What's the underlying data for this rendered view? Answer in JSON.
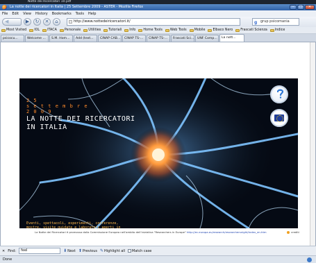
{
  "os_title": "Notte dei Ricercatori 10.pdf",
  "window": {
    "title": "La notte dei ricercatori in Italia | 25 Settembre 2009 - ASTER - Mozilla Firefox",
    "minimize": "–",
    "maximize": "□",
    "close": "✕"
  },
  "menu": [
    "File",
    "Edit",
    "View",
    "History",
    "Bookmarks",
    "Tools",
    "Help"
  ],
  "nav": {
    "back": "◀",
    "forward": "▶",
    "reload": "↻",
    "stop": "✕",
    "home": "⌂",
    "url": "http://www.nottedeiricercatori.it/",
    "search_engine": "g",
    "search_value": "grup psicomania",
    "go": "▶"
  },
  "bookmarks": [
    "Most Visited",
    "IOL",
    "ITACA",
    "Personale",
    "Utilities",
    "Tutoriali",
    "Info",
    "Home Tools",
    "Web Tools",
    "Mobile",
    "Elbaco Nero",
    "Frascati Scienza",
    "Indice"
  ],
  "tabs": [
    "psicocu...",
    "Welcome ...",
    "S.M. Hom...",
    "Add (text...",
    "CINAP CAB...",
    "CINAP TS-...",
    "CINAP TS-...",
    "Frascati Sci...",
    "UNF Comp...",
    "La nott..."
  ],
  "banner": {
    "date_line1": "2 5",
    "date_line2": "s e t t e m b r e",
    "date_line3": "2 0 0 9",
    "title_line1": "LA NOTTE DEI RICERCATORI",
    "title_line2": "IN ITALIA",
    "body": "Eventi, spettacoli, esperimenti, conferenze, mostre, visite guidate e laboratori aperti in compagnia dei ricercatori. Tutto nella stessa notte, in Italia. E in Europa.",
    "help_icon": "question-mark",
    "eu_icon": "eu-flag"
  },
  "footer": {
    "note": "La Notte dei Ricercatori è promossa dalla Commissione Europea nell'ambito dell'iniziativa \"Researchers in Europe\"",
    "link": "http://ec.europa.eu/research/researchersnight/index_en.htm",
    "credits": "crediti"
  },
  "findbar": {
    "close": "✕",
    "label": "Find:",
    "value": "feel",
    "next": "Next",
    "previous": "Previous",
    "highlight": "Highlight all",
    "match_case": "Match case"
  },
  "status": "Done",
  "colors": {
    "banner_bg": "#050a14",
    "date_orange": "#ff8a2a",
    "body_text": "#ffb84a",
    "titlebar": "#2f61a8"
  }
}
